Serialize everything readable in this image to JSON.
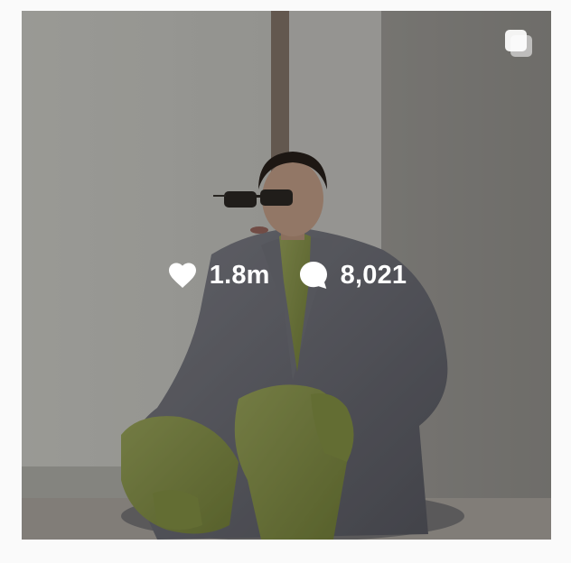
{
  "post": {
    "likes": "1.8m",
    "comments": "8,021",
    "type_icon": "carousel-icon",
    "like_icon": "heart-icon",
    "comment_icon": "comment-bubble-icon"
  },
  "colors": {
    "overlay_text": "#ffffff",
    "page_background": "#fafafa",
    "coat": "#6e6f78",
    "outfit": "#8e9a4e"
  }
}
